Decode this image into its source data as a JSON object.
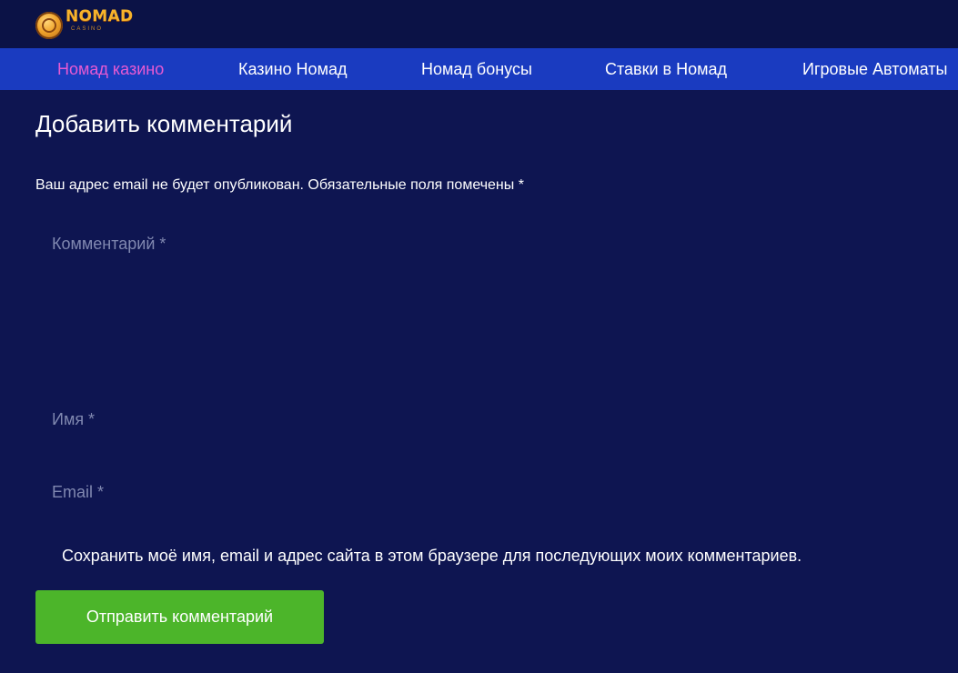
{
  "logo": {
    "word": "NOMAD",
    "sub": "CASINO",
    "icon": "medallion-icon"
  },
  "nav": {
    "items": [
      {
        "label": "Номад казино",
        "active": true
      },
      {
        "label": "Казино Номад",
        "active": false
      },
      {
        "label": "Номад бонусы",
        "active": false
      },
      {
        "label": "Ставки в Номад",
        "active": false
      },
      {
        "label": "Игровые Автоматы",
        "active": false
      }
    ]
  },
  "comment_form": {
    "heading": "Добавить комментарий",
    "notice": "Ваш адрес email не будет опубликован. Обязательные поля помечены *",
    "comment_placeholder": "Комментарий *",
    "name_placeholder": "Имя *",
    "email_placeholder": "Email *",
    "consent_label": "Сохранить моё имя, email и адрес сайта в этом браузере для последующих моих комментариев.",
    "submit_label": "Отправить комментарий"
  },
  "colors": {
    "background": "#0e1551",
    "navbar": "#1a3bc0",
    "active_nav": "#e85ad2",
    "submit": "#4cb52a",
    "logo": "#f6b32b"
  }
}
